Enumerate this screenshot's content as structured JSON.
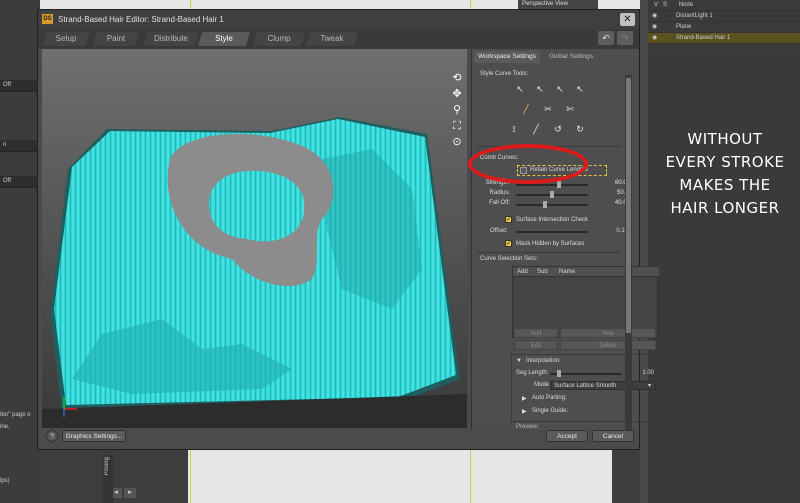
{
  "dialog": {
    "icon_text": "DS",
    "title": "Strand-Based Hair Editor: Strand-Based Hair 1",
    "close_symbol": "✕",
    "tabs": [
      "Setup",
      "Paint",
      "Distribute",
      "Style",
      "Clump",
      "Tweak"
    ],
    "active_tab": "Style",
    "undo_symbol": "↶",
    "redo_symbol": "↷"
  },
  "viewport": {
    "tools": [
      "camera-orbit-icon",
      "move-icon",
      "zoom-icon",
      "frame-icon",
      "reset-icon"
    ],
    "tool_glyphs": [
      "⟲",
      "✥",
      "⚲",
      "⛶",
      "⊙"
    ]
  },
  "panel": {
    "tabs": [
      "Workspace Settings",
      "Global Settings"
    ],
    "style_tools_label": "Style Curve Tools:",
    "comb_label": "Comb Curves:",
    "retain_label": "Retain Curve Lengths",
    "retain_checked": false,
    "sliders": [
      {
        "name": "Strength:",
        "value": "60.0%",
        "level": 0.6
      },
      {
        "name": "Radius:",
        "value": "50.00",
        "level": 0.5
      },
      {
        "name": "Fall Off:",
        "value": "40.0%",
        "level": 0.4
      }
    ],
    "surface_check_label": "Surface Intersection Check",
    "offset_label": "Offset:",
    "offset_value": "0.10",
    "mask_label": "Mask Hidden by Surfaces",
    "sets_label": "Curve Selection Sets:",
    "sets_columns": [
      "Add",
      "Sub",
      "Name"
    ],
    "set_buttons": [
      "Add",
      "New",
      "Edit",
      "Delete"
    ],
    "interp_label": "Interpolation:",
    "seg_label": "Seg Length:",
    "seg_value": "1.00",
    "seg_level": 0.1,
    "mode_label": "Mode:",
    "mode_value": "Surface Lattice Smooth",
    "auto_parting": "Auto Parting:",
    "single_guide": "Single Guide:",
    "preview_label": "Preview:"
  },
  "bottom": {
    "help": "?",
    "graphics": "Graphics Settings...",
    "accept": "Accept",
    "cancel": "Cancel"
  },
  "background": {
    "viewport_label": "Perspective View",
    "scene_header": [
      "V",
      "S",
      "Node"
    ],
    "scene_items": [
      "DistantLight 1",
      "Plane",
      "Strand-Based Hair 1"
    ],
    "left_off_1": "Off",
    "left_off_2": "Off",
    "left_text_1": "n",
    "left_text_2": "itor\" page o",
    "left_text_3": "ine.",
    "left_text_4": "ips)",
    "posing": "Posing"
  },
  "annotation": {
    "lines": [
      "WITHOUT",
      "EVERY STROKE",
      "MAKES THE",
      "HAIR LONGER"
    ]
  },
  "colors": {
    "hair": "#2fd6d6",
    "annotation_circle": "#e01a1a",
    "checkbox": "#e8c247"
  }
}
